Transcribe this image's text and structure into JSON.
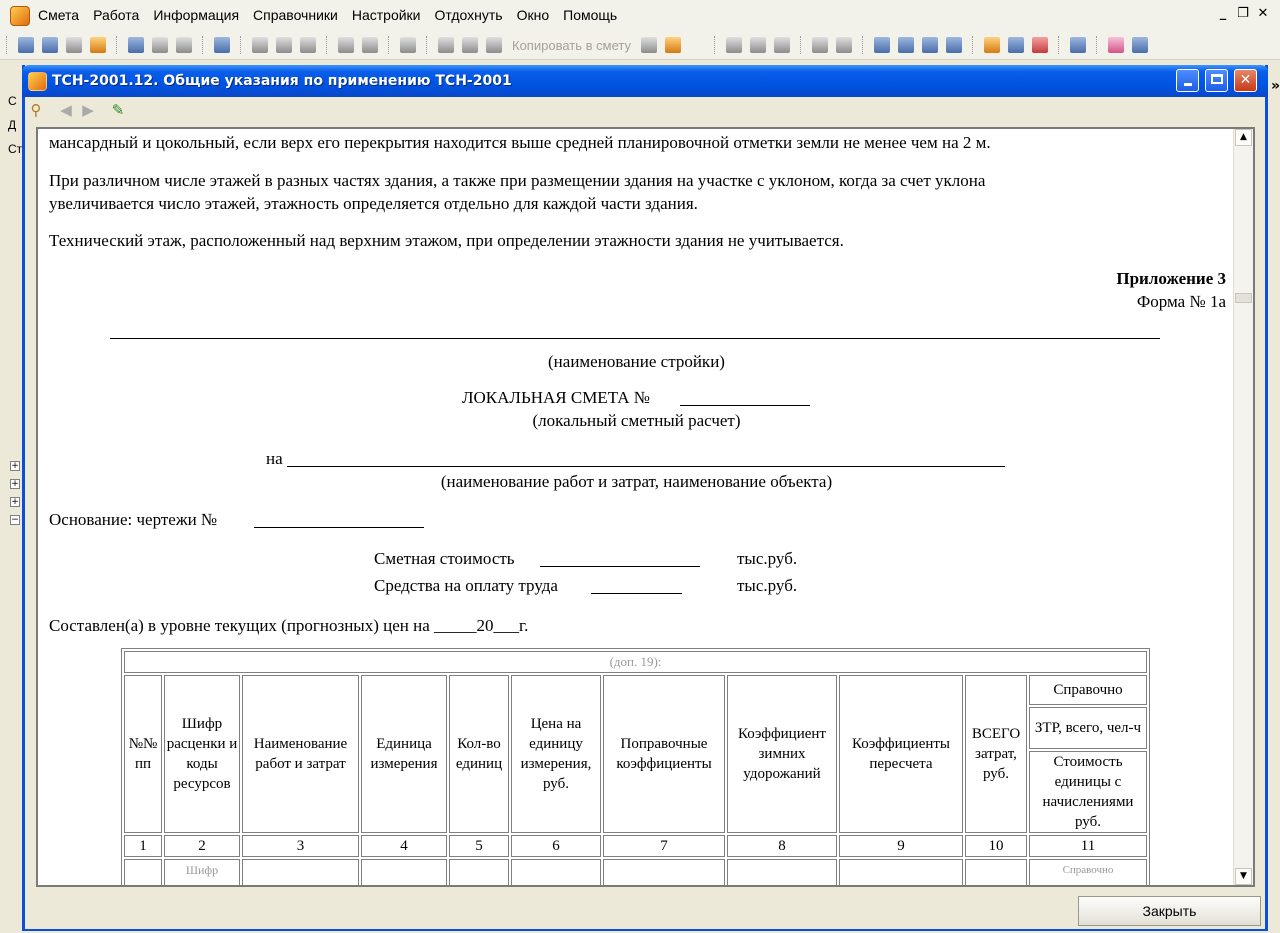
{
  "app": {
    "menu": [
      "Смета",
      "Работа",
      "Информация",
      "Справочники",
      "Настройки",
      "Отдохнуть",
      "Окно",
      "Помощь"
    ],
    "toolbar_copy_label": "Копировать в смету",
    "side_labels": [
      "С",
      "Д",
      "Ст"
    ]
  },
  "dialog": {
    "title": "ТСН-2001.12. Общие указания по применению ТСН-2001",
    "close_button": "Закрыть"
  },
  "doc": {
    "line1": "мансардный и цокольный, если верх его перекрытия находится выше средней планировочной отметки земли не менее чем на 2 м.",
    "para2_l1": "При различном числе этажей в разных частях здания, а также при размещении здания на участке с уклоном, когда за счет уклона",
    "para2_l2": "увеличивается число этажей, этажность определяется отдельно для каждой части здания.",
    "para3": "Технический этаж, расположенный над верхним этажом, при определении этажности здания не учитывается.",
    "appendix": "Приложение 3",
    "form": "Форма № 1а",
    "construction_caption": "(наименование стройки)",
    "smeta_title": "ЛОКАЛЬНАЯ СМЕТА №",
    "smeta_subtitle": "(локальный сметный расчет)",
    "na": "на",
    "work_caption": "(наименование работ и затрат, наименование объекта)",
    "basis": "Основание: чертежи №",
    "cost_label": "Сметная стоимость",
    "wage_label": "Средства на оплату труда",
    "unit": "тыс.руб.",
    "compiled": "Составлен(а) в уровне текущих (прогнозных) цен на _____20___г.",
    "table": {
      "caption": "(доп. 19):",
      "h1": "№№ пп",
      "h2": "Шифр расценки и коды ресурсов",
      "h3": "Наименование работ и затрат",
      "h4": "Единица измерения",
      "h5": "Кол-во единиц",
      "h6": "Цена на единицу измерения, руб.",
      "h7": "Поправочные коэффициенты",
      "h8": "Коэффициент зимних удорожаний",
      "h9": "Коэффициенты пересчета",
      "h10": "ВСЕГО затрат, руб.",
      "h11a": "Справочно",
      "h11b": "ЗТР, всего, чел-ч",
      "h11c": "Стоимость единицы с начислениями руб.",
      "nums": [
        "1",
        "2",
        "3",
        "4",
        "5",
        "6",
        "7",
        "8",
        "9",
        "10",
        "11"
      ],
      "partial_row": {
        "c2": "Шифр",
        "c11": "Справочно"
      }
    }
  }
}
